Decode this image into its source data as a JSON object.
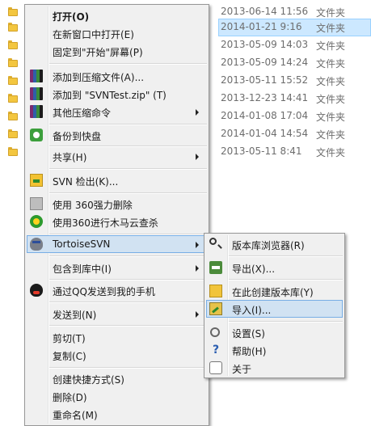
{
  "explorer": {
    "rows": [
      {
        "date": "2013-06-14 11:56",
        "type": "文件夹"
      },
      {
        "date": "2014-01-21 9:16",
        "type": "文件夹"
      },
      {
        "date": "2013-05-09 14:03",
        "type": "文件夹"
      },
      {
        "date": "2013-05-09 14:24",
        "type": "文件夹"
      },
      {
        "date": "2013-05-11 15:52",
        "type": "文件夹"
      },
      {
        "date": "2013-12-23 14:41",
        "type": "文件夹"
      },
      {
        "date": "2014-01-08 17:04",
        "type": "文件夹"
      },
      {
        "date": "2014-01-04 14:54",
        "type": "文件夹"
      },
      {
        "date": "2013-05-11 8:41",
        "type": "文件夹"
      }
    ]
  },
  "context_menu": {
    "items": [
      {
        "label": "打开(O)"
      },
      {
        "label": "在新窗口中打开(E)"
      },
      {
        "label": "固定到\"开始\"屏幕(P)"
      },
      {
        "label": "添加到压缩文件(A)..."
      },
      {
        "label": "添加到 \"SVNTest.zip\" (T)"
      },
      {
        "label": "其他压缩命令"
      },
      {
        "label": "备份到快盘"
      },
      {
        "label": "共享(H)"
      },
      {
        "label": "SVN 检出(K)..."
      },
      {
        "label": "使用 360强力删除"
      },
      {
        "label": "使用360进行木马云查杀"
      },
      {
        "label": "TortoiseSVN"
      },
      {
        "label": "包含到库中(I)"
      },
      {
        "label": "通过QQ发送到我的手机"
      },
      {
        "label": "发送到(N)"
      },
      {
        "label": "剪切(T)"
      },
      {
        "label": "复制(C)"
      },
      {
        "label": "创建快捷方式(S)"
      },
      {
        "label": "删除(D)"
      },
      {
        "label": "重命名(M)"
      }
    ]
  },
  "tortoise_submenu": {
    "items": [
      {
        "label": "版本库浏览器(R)"
      },
      {
        "label": "导出(X)..."
      },
      {
        "label": "在此创建版本库(Y)"
      },
      {
        "label": "导入(I)..."
      },
      {
        "label": "设置(S)"
      },
      {
        "label": "帮助(H)"
      },
      {
        "label": "关于"
      }
    ]
  },
  "colors": {
    "selection": "#cce8ff",
    "menu_highlight": "#d1e2f2",
    "menu_bg": "#f0f0f0"
  }
}
